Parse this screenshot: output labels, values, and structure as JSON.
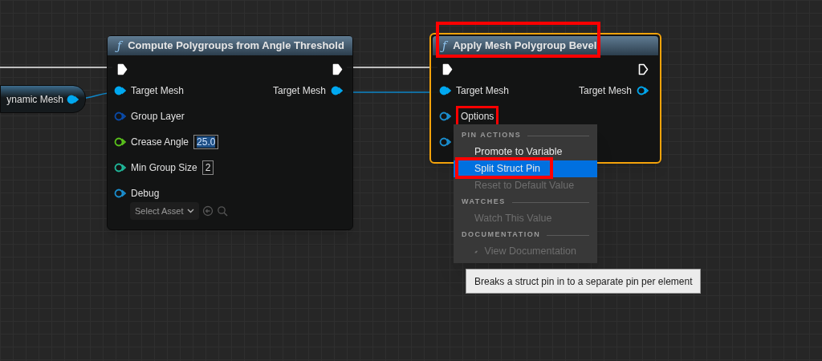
{
  "left_node": {
    "label": "ynamic Mesh",
    "color": "#00a8f0"
  },
  "nodes": [
    {
      "icon": "ƒ",
      "title": "Compute Polygroups from Angle Threshold",
      "selected": false,
      "highlighted": false,
      "exec_in_connected": true,
      "exec_out_connected": true,
      "inputs": [
        {
          "label": "Target Mesh",
          "color": "#00a8f0",
          "connected": true
        },
        {
          "label": "Group Layer",
          "color": "#0a4aa8",
          "connected": false
        },
        {
          "label": "Crease Angle",
          "color": "#5ac21c",
          "connected": false,
          "value": "25.0",
          "value_selected": true
        },
        {
          "label": "Min Group Size",
          "color": "#1fb89a",
          "connected": false,
          "value": "2",
          "value_selected": false
        },
        {
          "label": "Debug",
          "color": "#1a8fd0",
          "connected": false,
          "asset": "Select Asset"
        }
      ],
      "outputs": [
        {
          "label": "Target Mesh",
          "color": "#00a8f0",
          "connected": true
        }
      ]
    },
    {
      "icon": "ƒ",
      "title": "Apply Mesh Polygroup Bevel",
      "selected": true,
      "highlighted": true,
      "exec_in_connected": true,
      "exec_out_connected": false,
      "inputs": [
        {
          "label": "Target Mesh",
          "color": "#00a8f0",
          "connected": true
        },
        {
          "label": "Options",
          "color": "#1a8fd0",
          "connected": false,
          "highlighted": true
        },
        {
          "color": "#1a8fd0",
          "connected": false
        }
      ],
      "outputs": [
        {
          "label": "Target Mesh",
          "color": "#00a8f0",
          "connected": false
        }
      ]
    }
  ],
  "context_menu": {
    "sections": [
      {
        "header": "PIN ACTIONS",
        "items": [
          {
            "label": "Promote to Variable",
            "disabled": false,
            "selected": false,
            "highlighted": false,
            "has_icon": false
          },
          {
            "label": "Split Struct Pin",
            "disabled": false,
            "selected": true,
            "highlighted": true,
            "has_icon": false
          },
          {
            "label": "Reset to Default Value",
            "disabled": true,
            "selected": false,
            "highlighted": false,
            "has_icon": false
          }
        ]
      },
      {
        "header": "WATCHES",
        "items": [
          {
            "label": "Watch This Value",
            "disabled": true,
            "selected": false,
            "highlighted": false,
            "has_icon": false
          }
        ]
      },
      {
        "header": "DOCUMENTATION",
        "items": [
          {
            "label": "View Documentation",
            "disabled": true,
            "selected": false,
            "highlighted": false,
            "has_icon": true
          }
        ]
      }
    ]
  },
  "tooltip": {
    "text": "Breaks a struct pin in to a separate pin per element"
  }
}
